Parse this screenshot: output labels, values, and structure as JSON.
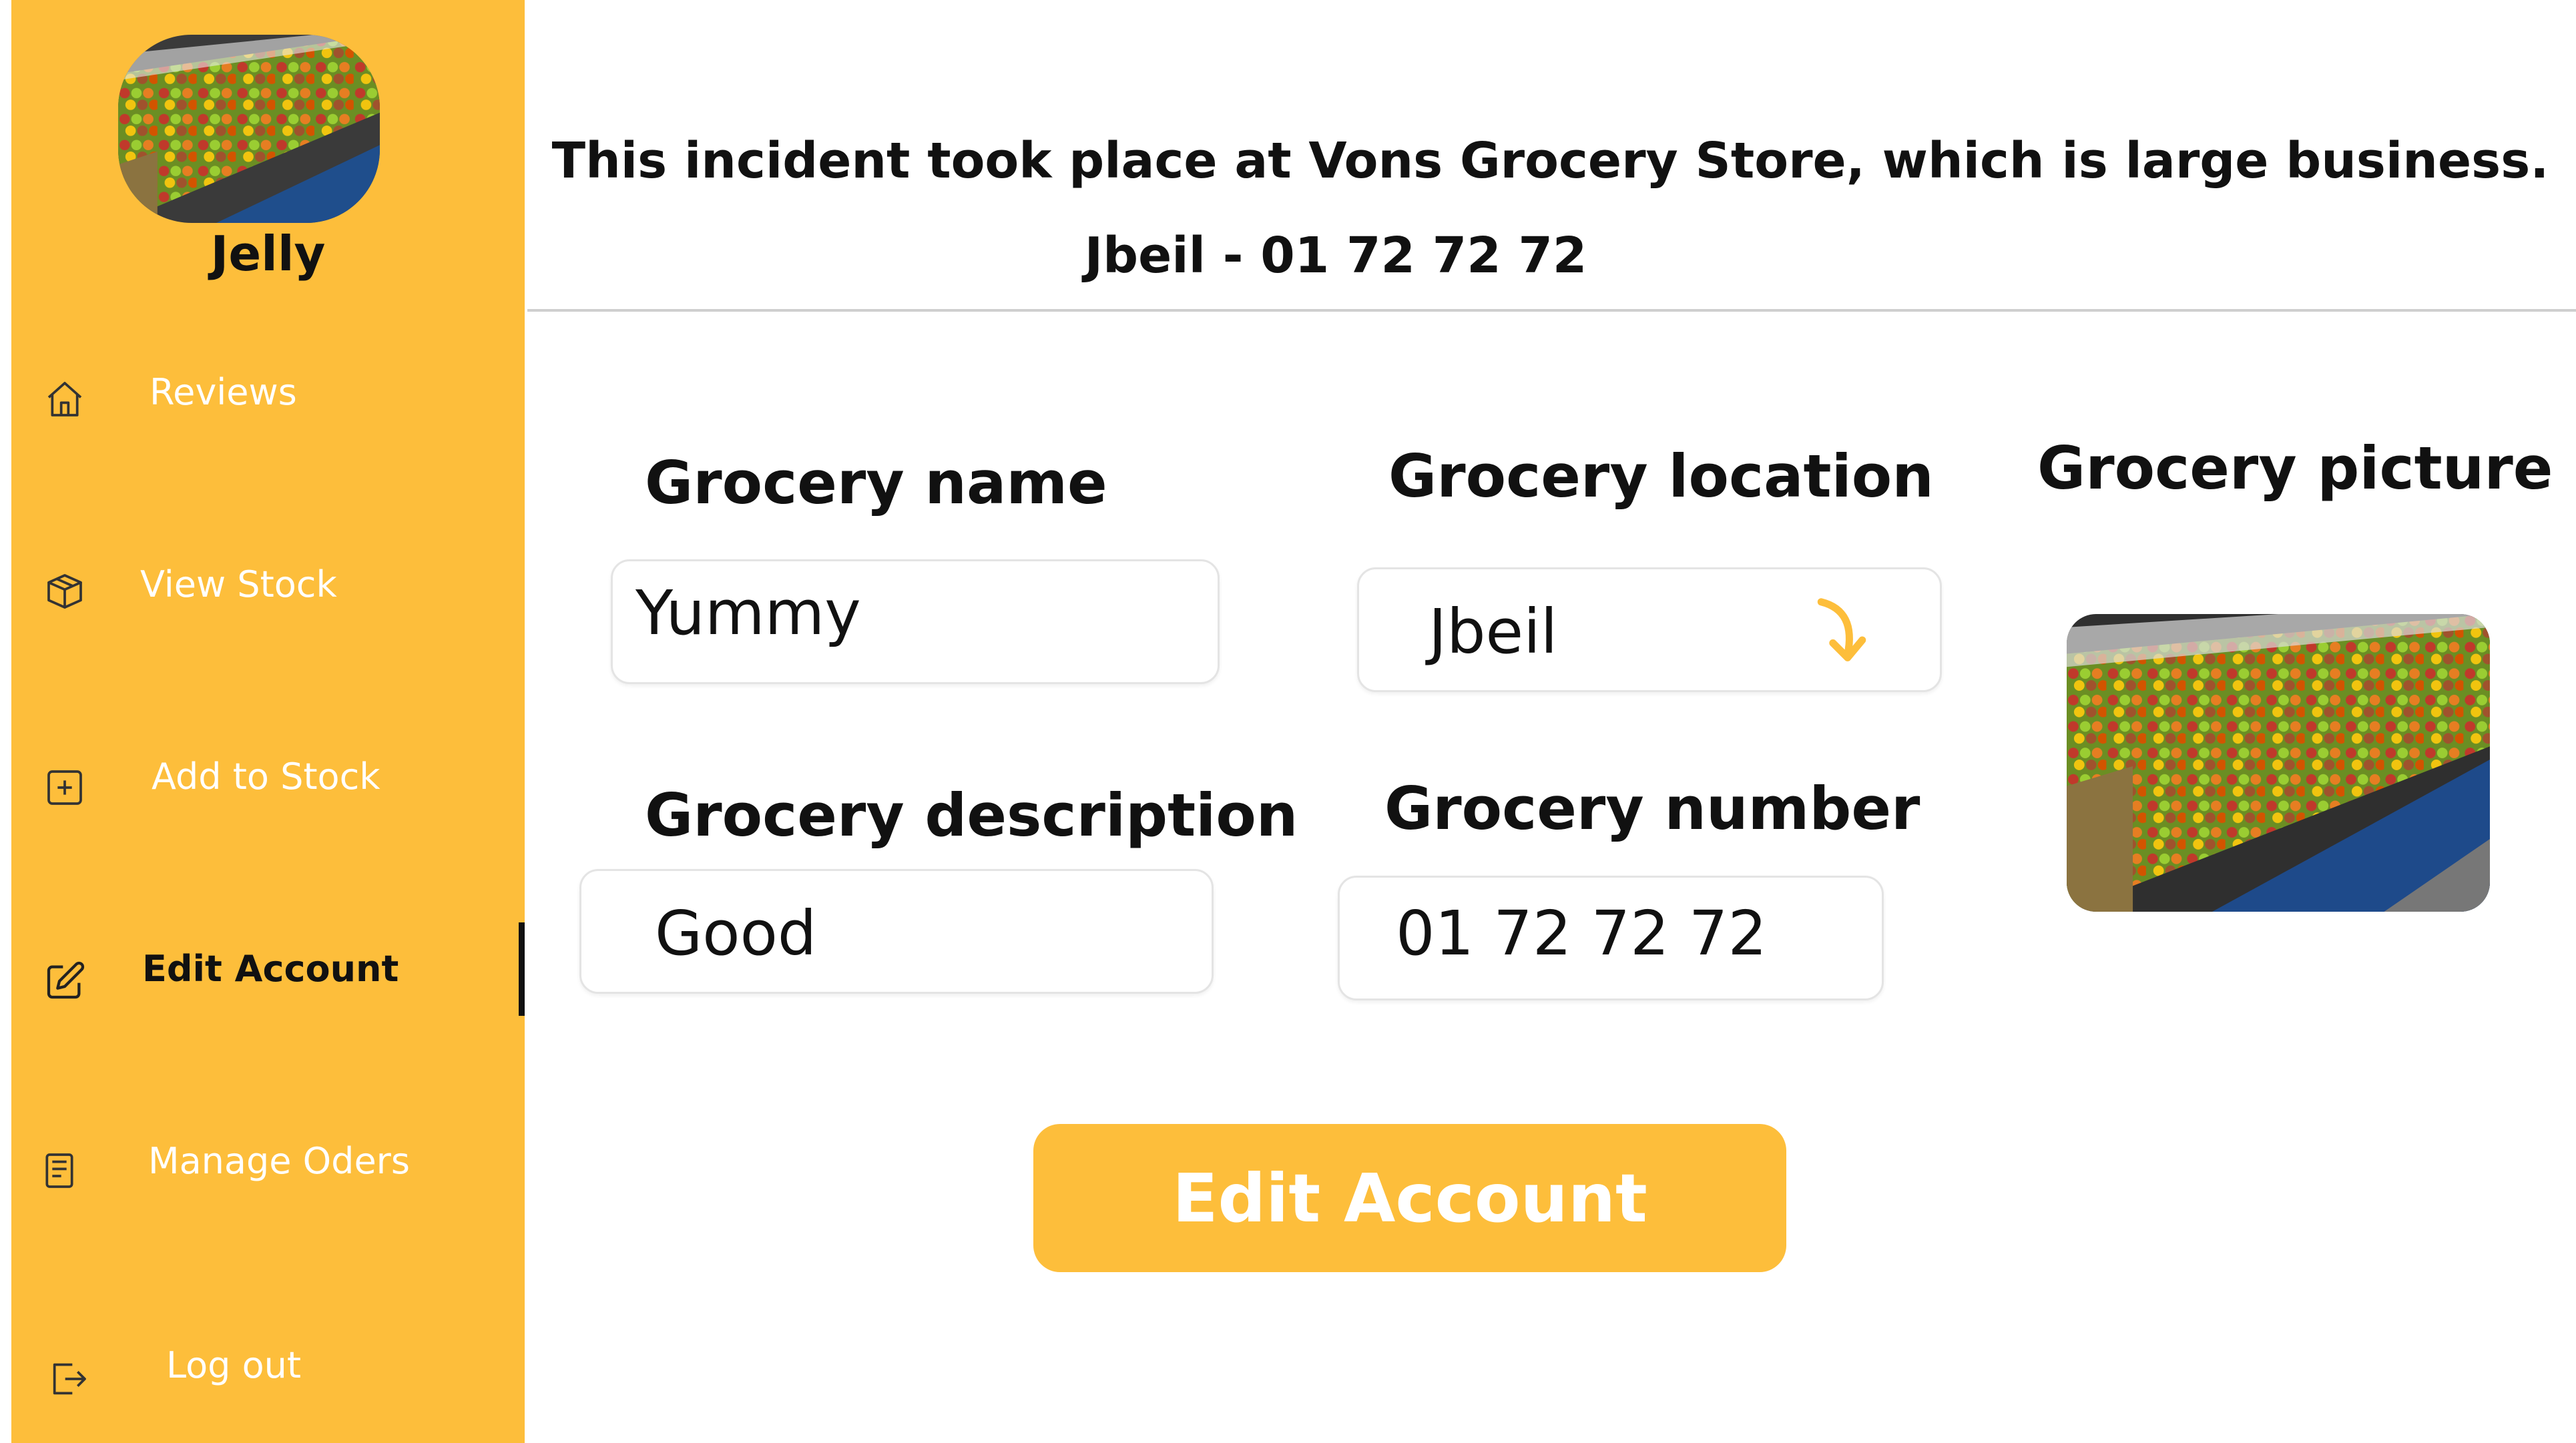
{
  "brand": {
    "name": "Jelly"
  },
  "sidebar": {
    "items": [
      {
        "label": "Reviews",
        "icon": "home-icon"
      },
      {
        "label": "View Stock",
        "icon": "box-icon"
      },
      {
        "label": "Add to Stock",
        "icon": "plus-square-icon"
      },
      {
        "label": "Edit Account",
        "icon": "edit-icon",
        "active": true
      },
      {
        "label": "Manage Oders",
        "icon": "clipboard-icon"
      },
      {
        "label": "Log out",
        "icon": "logout-icon"
      }
    ]
  },
  "header": {
    "title": "This incident took place at Vons Grocery Store, which is large business.",
    "subtitle": "Jbeil - 01 72 72 72"
  },
  "form": {
    "name_label": "Grocery name",
    "name_value": "Yummy",
    "location_label": "Grocery location",
    "location_value": "Jbeil",
    "description_label": "Grocery description",
    "description_value": "Good",
    "number_label": "Grocery number",
    "number_value": "01 72 72 72",
    "picture_label": "Grocery picture",
    "submit_label": "Edit Account"
  },
  "colors": {
    "accent": "#FDBE3B",
    "text": "#111111",
    "nav_text": "#ffffff"
  }
}
